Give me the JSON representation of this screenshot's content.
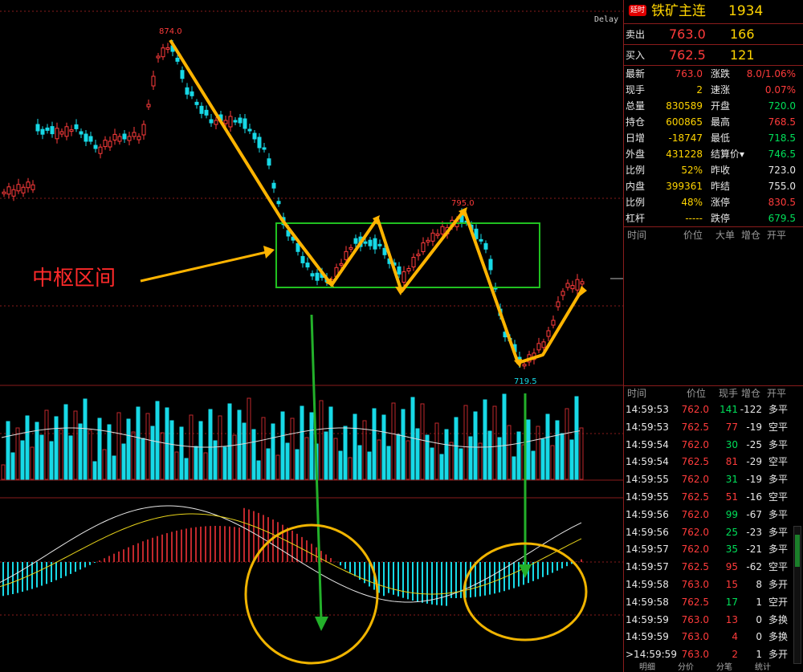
{
  "chart": {
    "delay_label": "Delay",
    "high_label": "874.0",
    "mid_high_label": "795.0",
    "low_label": "719.5",
    "zone_label": "中枢区间"
  },
  "quote": {
    "badge": "延时",
    "title": "铁矿主连",
    "code": "1934",
    "ask_label": "卖出",
    "ask_price": "763.0",
    "ask_vol": "166",
    "bid_label": "买入",
    "bid_price": "762.5",
    "bid_vol": "121",
    "left": [
      {
        "label": "最新",
        "value": "763.0",
        "color": "red"
      },
      {
        "label": "现手",
        "value": "2",
        "color": "yellow"
      },
      {
        "label": "总量",
        "value": "830589",
        "color": "yellow"
      },
      {
        "label": "持仓",
        "value": "600865",
        "color": "yellow"
      },
      {
        "label": "日增",
        "value": "-18747",
        "color": "yellow"
      },
      {
        "label": "外盘",
        "value": "431228",
        "color": "yellow"
      },
      {
        "label": "比例",
        "value": "52%",
        "color": "yellow"
      },
      {
        "label": "内盘",
        "value": "399361",
        "color": "yellow"
      },
      {
        "label": "比例",
        "value": "48%",
        "color": "yellow"
      },
      {
        "label": "杠杆",
        "value": "-----",
        "color": "yellow"
      }
    ],
    "right": [
      {
        "label": "涨跌",
        "value": "8.0/1.06%",
        "color": "red"
      },
      {
        "label": "速涨",
        "value": "0.07%",
        "color": "red"
      },
      {
        "label": "开盘",
        "value": "720.0",
        "color": "green"
      },
      {
        "label": "最高",
        "value": "768.5",
        "color": "red"
      },
      {
        "label": "最低",
        "value": "718.5",
        "color": "green"
      },
      {
        "label": "结算价▾",
        "value": "746.5",
        "color": "green"
      },
      {
        "label": "昨收",
        "value": "723.0",
        "color": "white"
      },
      {
        "label": "昨结",
        "value": "755.0",
        "color": "white"
      },
      {
        "label": "涨停",
        "value": "830.5",
        "color": "red"
      },
      {
        "label": "跌停",
        "value": "679.5",
        "color": "green"
      }
    ],
    "big_header": [
      "时间",
      "价位",
      "大单",
      "增仓",
      "开平"
    ],
    "tick_header": [
      "时间",
      "价位",
      "现手",
      "增仓",
      "开平"
    ],
    "ticks": [
      {
        "time": "14:59:53",
        "price": "762.0",
        "pc": "red",
        "vol": "141",
        "vc": "green",
        "chg": "-122",
        "type": "多平"
      },
      {
        "time": "14:59:53",
        "price": "762.5",
        "pc": "red",
        "vol": "77",
        "vc": "red",
        "chg": "-19",
        "type": "空平"
      },
      {
        "time": "14:59:54",
        "price": "762.0",
        "pc": "red",
        "vol": "30",
        "vc": "green",
        "chg": "-25",
        "type": "多平"
      },
      {
        "time": "14:59:54",
        "price": "762.5",
        "pc": "red",
        "vol": "81",
        "vc": "red",
        "chg": "-29",
        "type": "空平"
      },
      {
        "time": "14:59:55",
        "price": "762.0",
        "pc": "red",
        "vol": "31",
        "vc": "green",
        "chg": "-19",
        "type": "多平"
      },
      {
        "time": "14:59:55",
        "price": "762.5",
        "pc": "red",
        "vol": "51",
        "vc": "red",
        "chg": "-16",
        "type": "空平"
      },
      {
        "time": "14:59:56",
        "price": "762.0",
        "pc": "red",
        "vol": "99",
        "vc": "green",
        "chg": "-67",
        "type": "多平"
      },
      {
        "time": "14:59:56",
        "price": "762.0",
        "pc": "red",
        "vol": "25",
        "vc": "green",
        "chg": "-23",
        "type": "多平"
      },
      {
        "time": "14:59:57",
        "price": "762.0",
        "pc": "red",
        "vol": "35",
        "vc": "green",
        "chg": "-21",
        "type": "多平"
      },
      {
        "time": "14:59:57",
        "price": "762.5",
        "pc": "red",
        "vol": "95",
        "vc": "red",
        "chg": "-62",
        "type": "空平"
      },
      {
        "time": "14:59:58",
        "price": "763.0",
        "pc": "red",
        "vol": "15",
        "vc": "red",
        "chg": "8",
        "type": "多开"
      },
      {
        "time": "14:59:58",
        "price": "762.5",
        "pc": "red",
        "vol": "17",
        "vc": "green",
        "chg": "1",
        "type": "空开"
      },
      {
        "time": "14:59:59",
        "price": "763.0",
        "pc": "red",
        "vol": "13",
        "vc": "red",
        "chg": "0",
        "type": "多换"
      },
      {
        "time": "14:59:59",
        "price": "763.0",
        "pc": "red",
        "vol": "4",
        "vc": "red",
        "chg": "0",
        "type": "多换"
      },
      {
        "time": ">14:59:59",
        "price": "763.0",
        "pc": "red",
        "vol": "2",
        "vc": "red",
        "chg": "1",
        "type": "多开"
      }
    ],
    "tabs": [
      "明细",
      "分价",
      "分笔",
      "统计"
    ]
  }
}
